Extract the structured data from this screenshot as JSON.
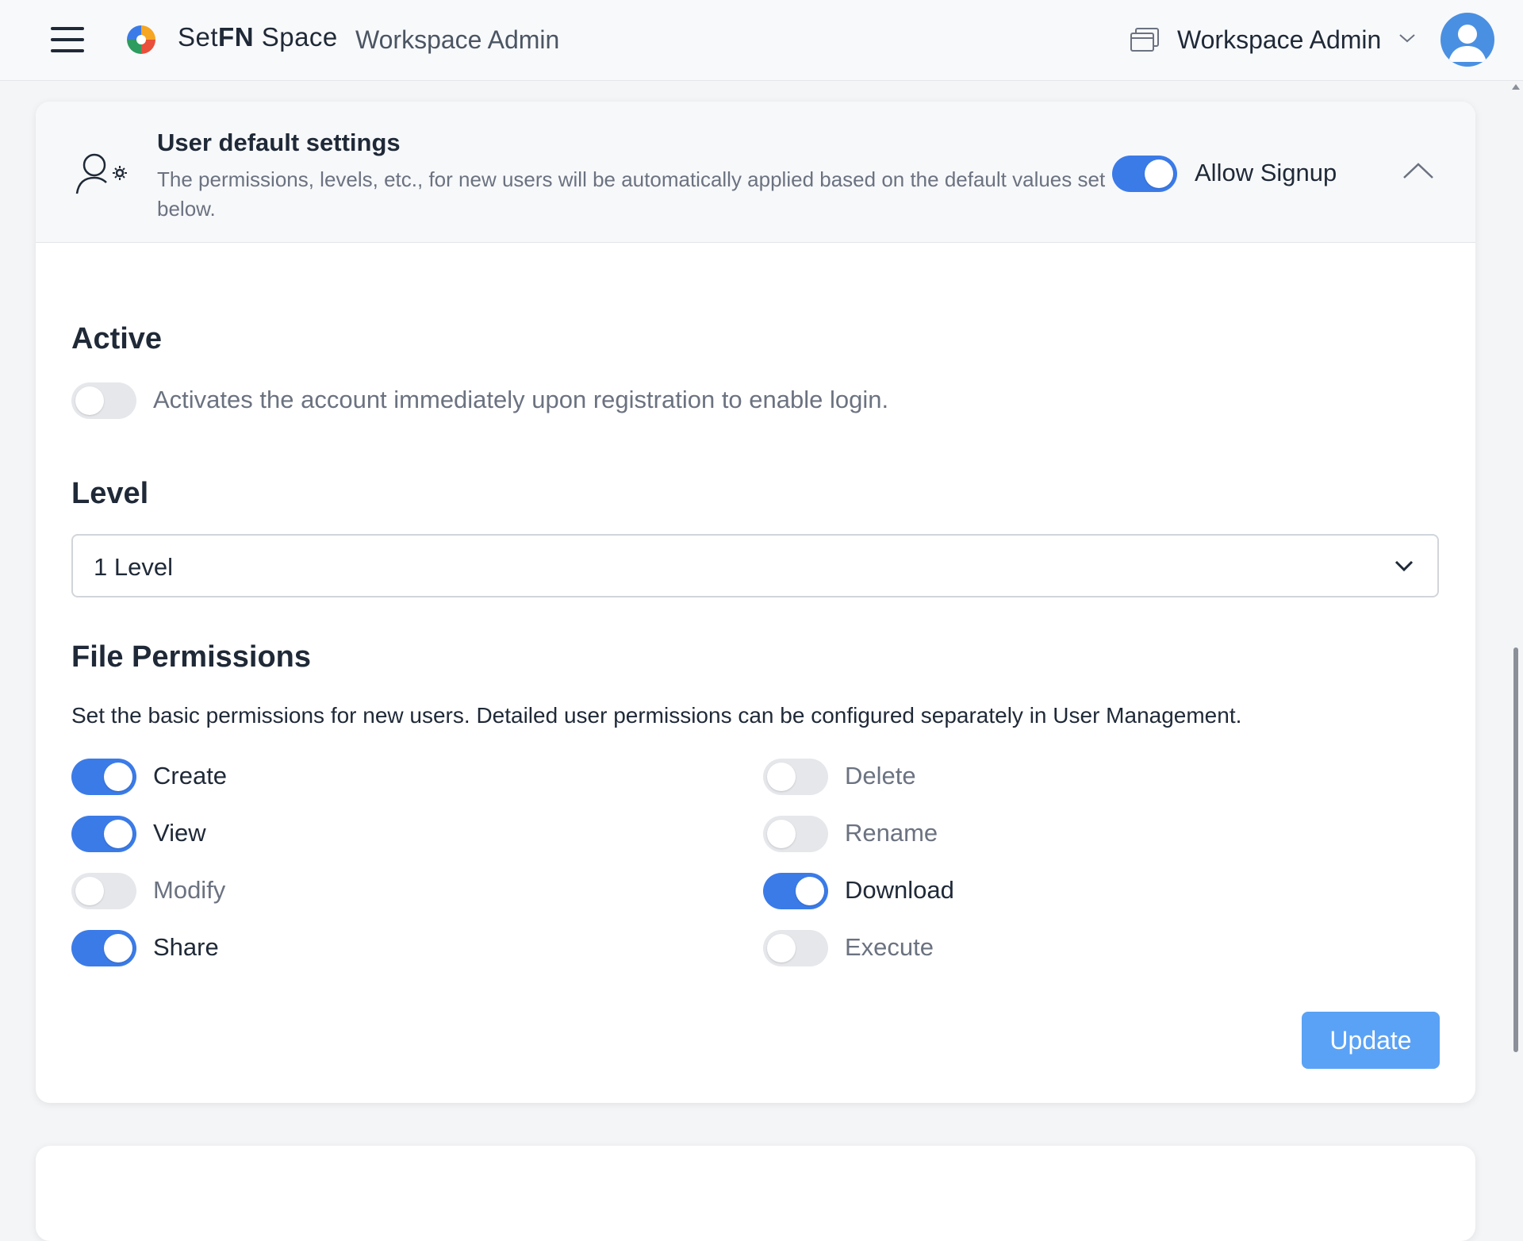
{
  "header": {
    "brand_set": "Set",
    "brand_fn": "FN",
    "brand_space": "Space",
    "brand_subtitle": "Workspace Admin",
    "workspace_name": "Workspace Admin",
    "icons": [
      "menu-icon",
      "brand-logo",
      "window-stack-icon",
      "chevron-down-icon",
      "avatar"
    ]
  },
  "card": {
    "title": "User default settings",
    "description": "The permissions, levels, etc., for new users will be automatically applied based on the default values set below.",
    "allow_signup_label": "Allow Signup",
    "allow_signup_on": true,
    "collapsed": false
  },
  "active": {
    "title": "Active",
    "description": "Activates the account immediately upon registration to enable login.",
    "on": false
  },
  "level": {
    "title": "Level",
    "selected": "1 Level"
  },
  "file_permissions": {
    "title": "File Permissions",
    "description": "Set the basic permissions for new users. Detailed user permissions can be configured separately in User Management.",
    "left": [
      {
        "label": "Create",
        "on": true
      },
      {
        "label": "View",
        "on": true
      },
      {
        "label": "Modify",
        "on": false
      },
      {
        "label": "Share",
        "on": true
      }
    ],
    "right": [
      {
        "label": "Delete",
        "on": false
      },
      {
        "label": "Rename",
        "on": false
      },
      {
        "label": "Download",
        "on": true
      },
      {
        "label": "Execute",
        "on": false
      }
    ]
  },
  "actions": {
    "update_label": "Update"
  },
  "colors": {
    "accent": "#3b7be8",
    "update_button": "#5aa2f5",
    "toggle_off": "#e5e7eb"
  }
}
